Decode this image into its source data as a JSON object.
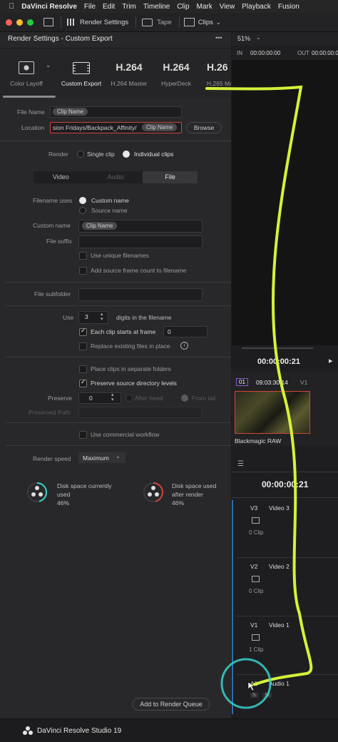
{
  "menubar": {
    "apple": "",
    "app": "DaVinci Resolve",
    "items": [
      "File",
      "Edit",
      "Trim",
      "Timeline",
      "Clip",
      "Mark",
      "View",
      "Playback",
      "Fusion"
    ]
  },
  "toolbar": {
    "render_settings": "Render Settings",
    "tape": "Tape",
    "clips": "Clips"
  },
  "render_panel": {
    "title": "Render Settings - Custom Export",
    "more": "•••",
    "presets": [
      {
        "label": "Color Layoff",
        "kind": "icon"
      },
      {
        "label": "Custom Export",
        "kind": "icon"
      },
      {
        "label": "H.264 Master",
        "big": "H.264"
      },
      {
        "label": "HyperDeck",
        "big": "H.264"
      },
      {
        "label": "H.265 Ma",
        "big": "H.26"
      }
    ],
    "file_name_label": "File Name",
    "file_name_chip": "Clip Name",
    "location_label": "Location",
    "location_value": "sion Fridays/Backpack_Affinity/",
    "location_chip": "Clip Name",
    "browse": "Browse",
    "render_label": "Render",
    "single_clip": "Single clip",
    "individual_clips": "Individual clips",
    "tabs": [
      "Video",
      "Audio",
      "File"
    ],
    "filename_uses_label": "Filename uses",
    "custom_name_option": "Custom name",
    "source_name_option": "Source name",
    "custom_name_label": "Custom name",
    "custom_name_chip": "Clip Name",
    "file_suffix_label": "File suffix",
    "use_unique": "Use unique filenames",
    "add_frame_count": "Add source frame count to filename",
    "file_subfolder_label": "File subfolder",
    "use_label": "Use",
    "use_digits": "3",
    "digits_text": "digits in the filename",
    "each_clip_starts": "Each clip starts at frame",
    "start_frame": "0",
    "replace_existing": "Replace existing files in place",
    "place_clips": "Place clips in separate folders",
    "preserve_dirs": "Preserve source directory levels",
    "preserve_label": "Preserve",
    "preserve_value": "0",
    "after_head": "After head",
    "from_tail": "From tail",
    "preserved_path_label": "Preserved Path",
    "commercial": "Use commercial workflow",
    "render_speed_label": "Render speed",
    "render_speed_value": "Maximum",
    "disk_current_line1": "Disk space currently",
    "disk_current_line2": "used",
    "disk_current_pct": "46%",
    "disk_after_line1": "Disk space used",
    "disk_after_line2": "after render",
    "disk_after_pct": "46%",
    "add_to_queue": "Add to Render Queue"
  },
  "viewer": {
    "zoom": "51%",
    "in_label": "IN",
    "in_tc": "00:00:00:00",
    "out_label": "OUT",
    "out_tc": "00:00:00:00",
    "timecode": "00:00:00:21",
    "clip_index": "01",
    "clip_tc": "09:03:30:14",
    "clip_track": "V1",
    "clip_name": "Blackmagic RAW",
    "timeline_tc": "00:00:00:21"
  },
  "tracks": [
    {
      "id": "V3",
      "name": "Video 3",
      "clips": "0 Clip"
    },
    {
      "id": "V2",
      "name": "Video 2",
      "clips": "0 Clip"
    },
    {
      "id": "V1",
      "name": "Video 1",
      "clips": "1 Clip"
    },
    {
      "id": "A1",
      "name": "Audio 1",
      "solo": "S",
      "mute": "M"
    }
  ],
  "footer": {
    "brand": "DaVinci Resolve Studio 19"
  },
  "colors": {
    "accent_red": "#d0443a",
    "annotation": "#d4f23a",
    "ring": "#3ad0c8"
  }
}
